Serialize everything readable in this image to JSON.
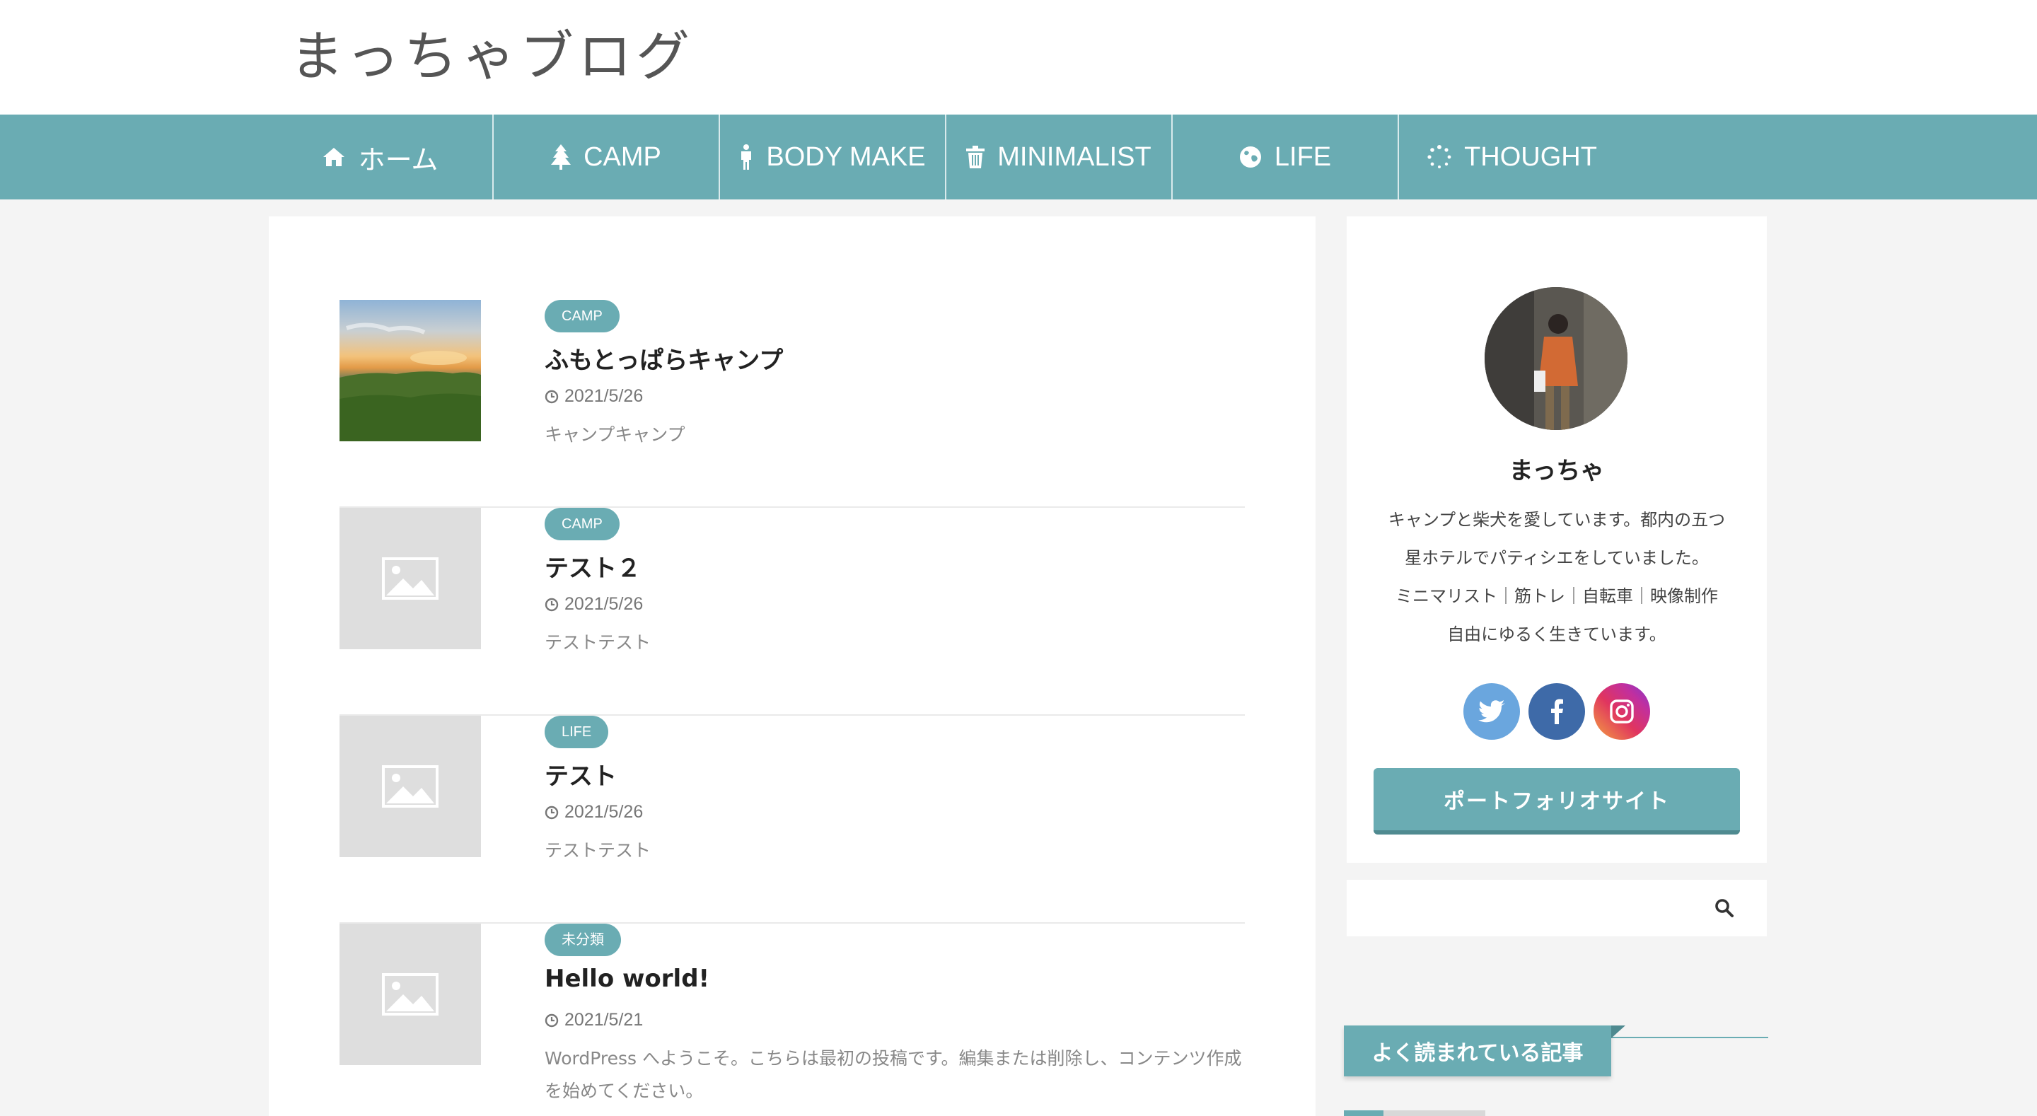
{
  "site": {
    "logo": "まっちゃブログ"
  },
  "nav": {
    "items": [
      {
        "label": "ホーム",
        "icon": "home-icon"
      },
      {
        "label": "CAMP",
        "icon": "tree-icon"
      },
      {
        "label": "BODY MAKE",
        "icon": "person-icon"
      },
      {
        "label": "MINIMALIST",
        "icon": "trash-icon"
      },
      {
        "label": "LIFE",
        "icon": "globe-icon"
      },
      {
        "label": "THOUGHT",
        "icon": "spinner-icon"
      }
    ]
  },
  "posts": [
    {
      "category": "CAMP",
      "title": "ふもとっぱらキャンプ",
      "date": "2021/5/26",
      "excerpt": "キャンプキャンプ",
      "thumbnail": "photo"
    },
    {
      "category": "CAMP",
      "title": "テスト２",
      "date": "2021/5/26",
      "excerpt": "テストテスト",
      "thumbnail": "placeholder"
    },
    {
      "category": "LIFE",
      "title": "テスト",
      "date": "2021/5/26",
      "excerpt": "テストテスト",
      "thumbnail": "placeholder"
    },
    {
      "category": "未分類",
      "title": "Hello world!",
      "date": "2021/5/21",
      "excerpt": "WordPress へようこそ。こちらは最初の投稿です。編集または削除し、コンテンツ作成を始めてください。",
      "thumbnail": "placeholder"
    }
  ],
  "profile": {
    "name": "まっちゃ",
    "bio_lines": [
      "キャンプと柴犬を愛しています。都内の五つ",
      "星ホテルでパティシエをしていました。",
      "ミニマリスト｜筋トレ｜自転車｜映像制作",
      "自由にゆるく生きています。"
    ],
    "social": [
      {
        "name": "twitter",
        "icon": "twitter-icon",
        "color": "#6aa6de"
      },
      {
        "name": "facebook",
        "icon": "facebook-icon",
        "color": "#3e6aa8"
      },
      {
        "name": "instagram",
        "icon": "instagram-icon",
        "color": "#e0355f"
      }
    ],
    "portfolio_label": "ポートフォリオサイト"
  },
  "search": {
    "placeholder": "",
    "icon": "search-icon"
  },
  "popular": {
    "heading": "よく読まれている記事"
  },
  "colors": {
    "accent": "#6aacb3",
    "background": "#f4f4f4"
  }
}
